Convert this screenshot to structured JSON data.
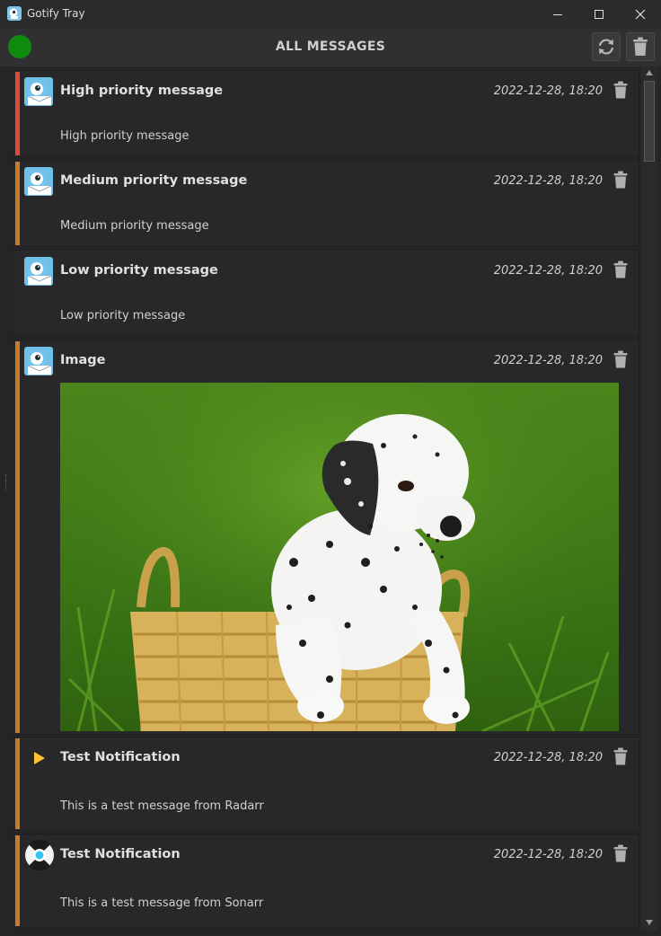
{
  "window": {
    "title": "Gotify Tray",
    "controls": [
      "minimize",
      "maximize",
      "close"
    ]
  },
  "header": {
    "title": "ALL MESSAGES",
    "status_color": "#0f8c0f",
    "refresh_icon": "refresh-icon",
    "delete_all_icon": "trash-icon"
  },
  "colors": {
    "priority_high": "#e0473d",
    "priority_medium": "#c87b2a",
    "priority_low": "#28282b",
    "background": "#252528",
    "card": "#28282b"
  },
  "messages": [
    {
      "title": "High priority message",
      "date": "2022-12-28, 18:20",
      "body": "High priority message",
      "priority": "high",
      "avatar": "gotify-icon"
    },
    {
      "title": "Medium priority message",
      "date": "2022-12-28, 18:20",
      "body": "Medium priority message",
      "priority": "medium",
      "avatar": "gotify-icon"
    },
    {
      "title": "Low priority message",
      "date": "2022-12-28, 18:20",
      "body": "Low priority message",
      "priority": "low",
      "avatar": "gotify-icon"
    },
    {
      "title": "Image",
      "date": "2022-12-28, 18:20",
      "body": "",
      "priority": "medium",
      "avatar": "gotify-icon",
      "image": "dalmatian-puppy-in-basket"
    },
    {
      "title": "Test Notification",
      "date": "2022-12-28, 18:20",
      "body": "This is a test message from Radarr",
      "priority": "medium",
      "avatar": "radarr-icon"
    },
    {
      "title": "Test Notification",
      "date": "2022-12-28, 18:20",
      "body": "This is a test message from Sonarr",
      "priority": "medium",
      "avatar": "sonarr-icon"
    }
  ]
}
